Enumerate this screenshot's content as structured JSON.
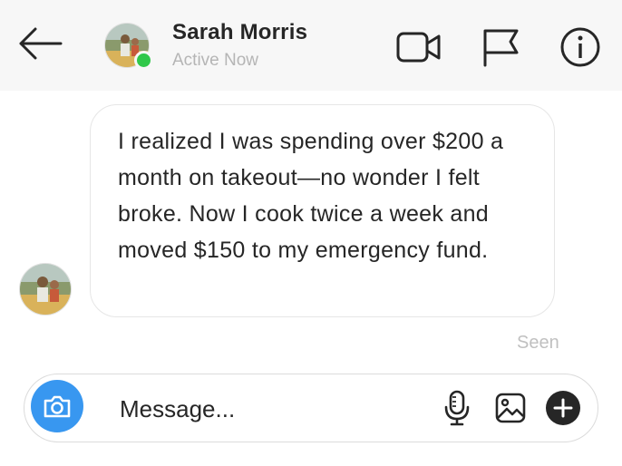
{
  "header": {
    "back_icon": "arrow-left-icon",
    "contact_name": "Sarah Morris",
    "status": "Active Now",
    "online_color": "#30c84a",
    "actions": [
      {
        "name": "video-call",
        "icon": "video-camera-icon"
      },
      {
        "name": "report",
        "icon": "flag-icon"
      },
      {
        "name": "info",
        "icon": "info-icon"
      }
    ]
  },
  "conversation": {
    "messages": [
      {
        "sender": "Sarah Morris",
        "text": "I realized I was spending over $200 a month on takeout—no wonder I felt broke. Now I cook twice a week and moved $150 to my emergency fund."
      }
    ],
    "receipt": "Seen"
  },
  "composer": {
    "placeholder": "Message...",
    "camera_icon": "camera-icon",
    "accent": "#3897f0",
    "icons": [
      "microphone-icon",
      "image-icon",
      "plus-circle-icon"
    ]
  }
}
